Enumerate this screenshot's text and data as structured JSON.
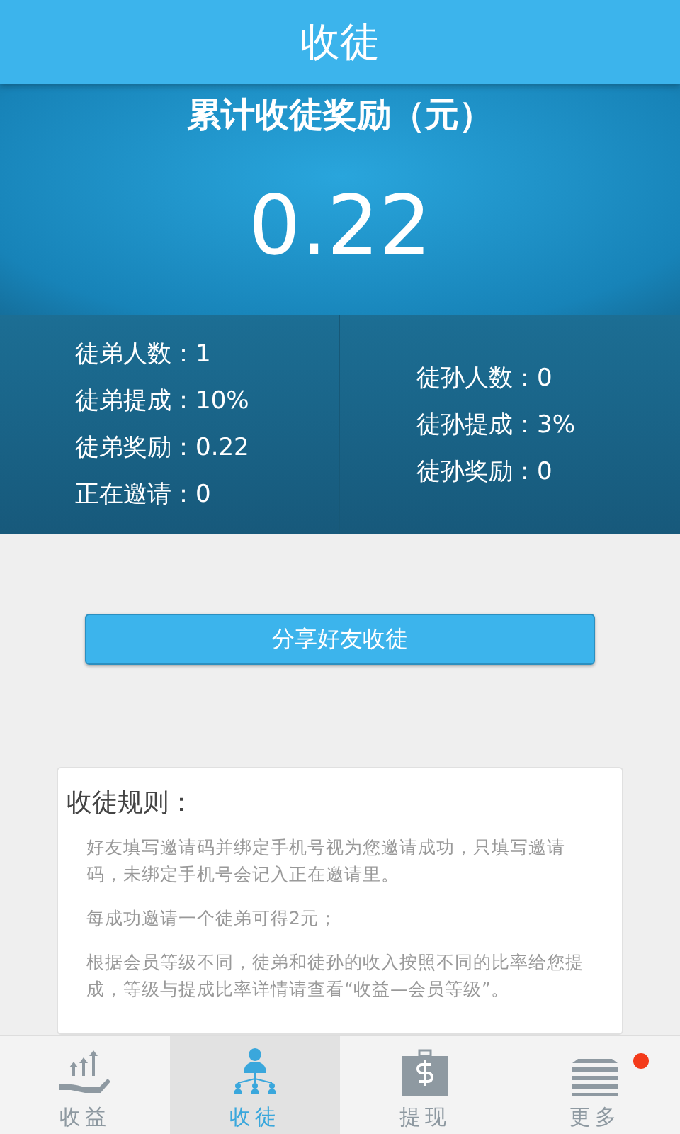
{
  "header": {
    "title": "收徒"
  },
  "summary": {
    "label": "累计收徒奖励（元）",
    "amount": "0.22"
  },
  "stats_left": [
    "徒弟人数：1",
    "徒弟提成：10%",
    "徒弟奖励：0.22",
    "正在邀请：0"
  ],
  "stats_right": [
    "徒孙人数：0",
    "徒孙提成：3%",
    "徒孙奖励：0"
  ],
  "share_button": "分享好友收徒",
  "rules": {
    "title": "收徒规则：",
    "paragraphs": [
      "好友填写邀请码并绑定手机号视为您邀请成功，只填写邀请码，未绑定手机号会记入正在邀请里。",
      "每成功邀请一个徒弟可得2元；",
      "根据会员等级不同，徒弟和徒孙的收入按照不同的比率给您提成，等级与提成比率详情请查看“收益—会员等级”。"
    ]
  },
  "tabs": [
    {
      "kind": "income",
      "label": "收益",
      "selected": false,
      "badge": false
    },
    {
      "kind": "apprentice",
      "label": "收徒",
      "selected": true,
      "badge": false
    },
    {
      "kind": "withdraw",
      "label": "提现",
      "selected": false,
      "badge": false
    },
    {
      "kind": "more",
      "label": "更多",
      "selected": false,
      "badge": true
    }
  ]
}
